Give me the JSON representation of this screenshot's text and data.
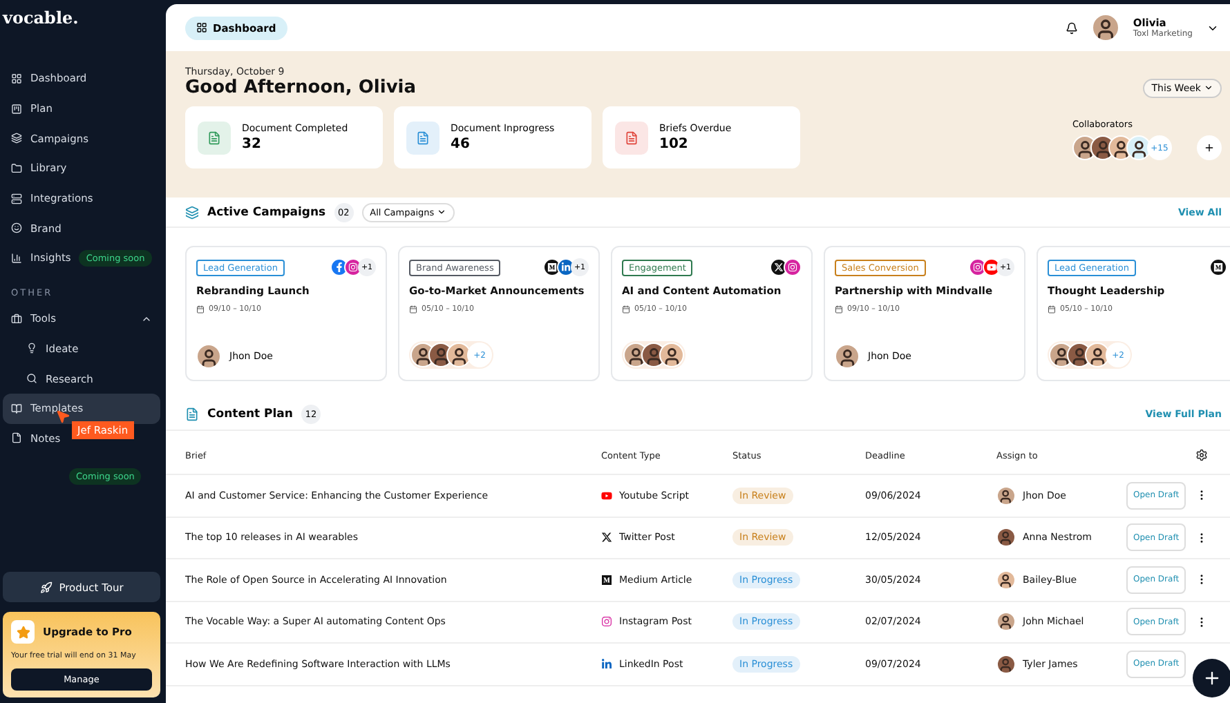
{
  "brand": {
    "logo": "vocable."
  },
  "sidebar": {
    "items": [
      {
        "label": "Dashboard",
        "selected": false
      },
      {
        "label": "Plan",
        "selected": false
      },
      {
        "label": "Campaigns",
        "selected": false
      },
      {
        "label": "Library",
        "selected": false
      },
      {
        "label": "Integrations",
        "selected": false
      },
      {
        "label": "Brand",
        "selected": false
      },
      {
        "label": "Insights",
        "selected": false,
        "badge": "Coming soon"
      }
    ],
    "section_label": "OTHER",
    "other_items": [
      {
        "label": "Tools",
        "selected": false,
        "expanded": true,
        "children": [
          {
            "label": "Ideate",
            "selected": false
          },
          {
            "label": "Research",
            "selected": false
          }
        ]
      },
      {
        "label": "Templates",
        "selected": true
      },
      {
        "label": "Notes",
        "selected": false,
        "badge": "Coming soon"
      }
    ],
    "product_tour": "Product Tour",
    "upgrade": {
      "title": "Upgrade to Pro",
      "text": "Your free trial will end on 31 May",
      "button": "Manage"
    }
  },
  "cursor": {
    "name": "Jef Raskin"
  },
  "topbar": {
    "tab": "Dashboard",
    "user": {
      "name": "Olivia",
      "team": "Toxl Marketing"
    }
  },
  "hero": {
    "date": "Thursday, October 9",
    "greeting": "Good Afternoon, Olivia",
    "period": "This Week",
    "stats": [
      {
        "label": "Document Completed",
        "value": "32",
        "color": "#2f9a5a"
      },
      {
        "label": "Document Inprogress",
        "value": "46",
        "color": "#2a8fd6"
      },
      {
        "label": "Briefs Overdue",
        "value": "102",
        "color": "#e0443a"
      }
    ],
    "collaborators": {
      "label": "Collaborators",
      "more": "+15"
    }
  },
  "campaigns": {
    "title": "Active Campaigns",
    "count": "02",
    "filter": "All Campaigns",
    "link": "View All",
    "items": [
      {
        "tag": "Lead Generation",
        "color": "#2a8fd6",
        "title": "Rebranding Launch",
        "dates": "09/10 – 10/10",
        "socials": [
          {
            "kind": "facebook"
          },
          {
            "kind": "instagram"
          }
        ],
        "more": "+1",
        "assignee": "Jhon Doe"
      },
      {
        "tag": "Brand Awareness",
        "color": "#555a63",
        "title": "Go-to-Market Announcements",
        "dates": "05/10 – 10/10",
        "socials": [
          {
            "kind": "medium"
          },
          {
            "kind": "linkedin"
          }
        ],
        "more": "+1",
        "avatars_more": "+2"
      },
      {
        "tag": "Engagement",
        "color": "#2f7a4f",
        "title": "AI and Content Automation",
        "dates": "05/10 – 10/10",
        "socials": [
          {
            "kind": "x"
          },
          {
            "kind": "instagram"
          }
        ]
      },
      {
        "tag": "Sales Conversion",
        "color": "#c8801c",
        "title": "Partnership with Mindvalle",
        "dates": "09/10 – 10/10",
        "socials": [
          {
            "kind": "instagram"
          },
          {
            "kind": "youtube"
          }
        ],
        "more": "+1",
        "assignee": "Jhon Doe"
      },
      {
        "tag": "Lead Generation",
        "color": "#2a8fd6",
        "title": "Thought Leadership",
        "dates": "05/10 – 10/10",
        "socials": [
          {
            "kind": "medium"
          }
        ],
        "avatars_more": "+2"
      }
    ]
  },
  "content_plan": {
    "title": "Content Plan",
    "count": "12",
    "link": "View Full Plan",
    "columns": [
      "Brief",
      "Content Type",
      "Status",
      "Deadline",
      "Assign to"
    ],
    "rows": [
      {
        "brief": "AI and Customer Service: Enhancing the Customer Experience",
        "type": {
          "label": "Youtube Script",
          "kind": "youtube"
        },
        "status": {
          "label": "In Review",
          "color": "#c8801c"
        },
        "deadline": "09/06/2024",
        "assignee": "Jhon Doe",
        "action": "Open Draft"
      },
      {
        "brief": "The top 10 releases in AI wearables",
        "type": {
          "label": "Twitter Post",
          "kind": "x"
        },
        "status": {
          "label": "In Review",
          "color": "#c8801c"
        },
        "deadline": "12/05/2024",
        "assignee": "Anna Nestrom",
        "action": "Open Draft"
      },
      {
        "brief": "The Role of Open Source in Accelerating AI Innovation",
        "type": {
          "label": "Medium Article",
          "kind": "medium"
        },
        "status": {
          "label": "In Progress",
          "color": "#2a8fd6"
        },
        "deadline": "30/05/2024",
        "assignee": "Bailey-Blue",
        "action": "Open Draft"
      },
      {
        "brief": "The Vocable Way: a Super AI automating Content Ops",
        "type": {
          "label": "Instagram Post",
          "kind": "instagram"
        },
        "status": {
          "label": "In Progress",
          "color": "#2a8fd6"
        },
        "deadline": "02/07/2024",
        "assignee": "John Michael",
        "action": "Open Draft"
      },
      {
        "brief": "How We Are Redefining Software Interaction with LLMs",
        "type": {
          "label": "LinkedIn Post",
          "kind": "linkedin"
        },
        "status": {
          "label": "In Progress",
          "color": "#2a8fd6"
        },
        "deadline": "09/07/2024",
        "assignee": "Tyler James",
        "action": "Open Draft"
      }
    ]
  }
}
